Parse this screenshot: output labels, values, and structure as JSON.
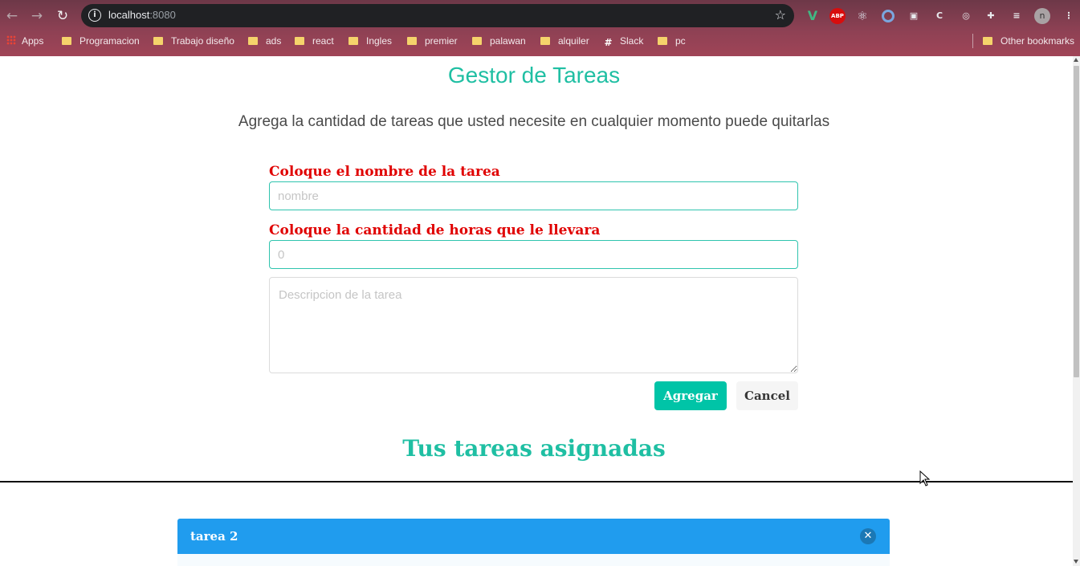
{
  "browser": {
    "url_host": "localhost",
    "url_port": ":8080",
    "profile_initial": "n",
    "extensions": {
      "abp": "ABP"
    },
    "bookmarks": [
      {
        "label": "Apps",
        "icon": "apps-grid-icon"
      },
      {
        "label": "Programacion",
        "icon": "folder-icon"
      },
      {
        "label": "Trabajo diseño",
        "icon": "folder-icon"
      },
      {
        "label": "ads",
        "icon": "folder-icon"
      },
      {
        "label": "react",
        "icon": "folder-icon"
      },
      {
        "label": "Ingles",
        "icon": "folder-icon"
      },
      {
        "label": "premier",
        "icon": "folder-icon"
      },
      {
        "label": "palawan",
        "icon": "folder-icon"
      },
      {
        "label": "alquiler",
        "icon": "folder-icon"
      },
      {
        "label": "Slack",
        "icon": "slack-icon"
      },
      {
        "label": "pc",
        "icon": "folder-icon"
      },
      {
        "label": "Other bookmarks",
        "icon": "folder-icon"
      }
    ]
  },
  "page": {
    "title": "Gestor de Tareas",
    "subtitle": "Agrega la cantidad de tareas que usted necesite en cualquier momento puede quitarlas",
    "form": {
      "name_label": "Coloque el nombre de la tarea",
      "name_placeholder": "nombre",
      "hours_label": "Coloque la cantidad de horas que le llevara",
      "hours_placeholder": "0",
      "description_placeholder": "Descripcion de la tarea",
      "add_button": "Agregar",
      "cancel_button": "Cancel"
    },
    "tasks_heading": "Tus tareas asignadas",
    "tasks": [
      {
        "name": "tarea 2"
      }
    ]
  },
  "colors": {
    "accent": "#1fbfa3",
    "primary_button": "#00c4a7",
    "label_red": "#e00000",
    "task_header": "#209cee"
  }
}
